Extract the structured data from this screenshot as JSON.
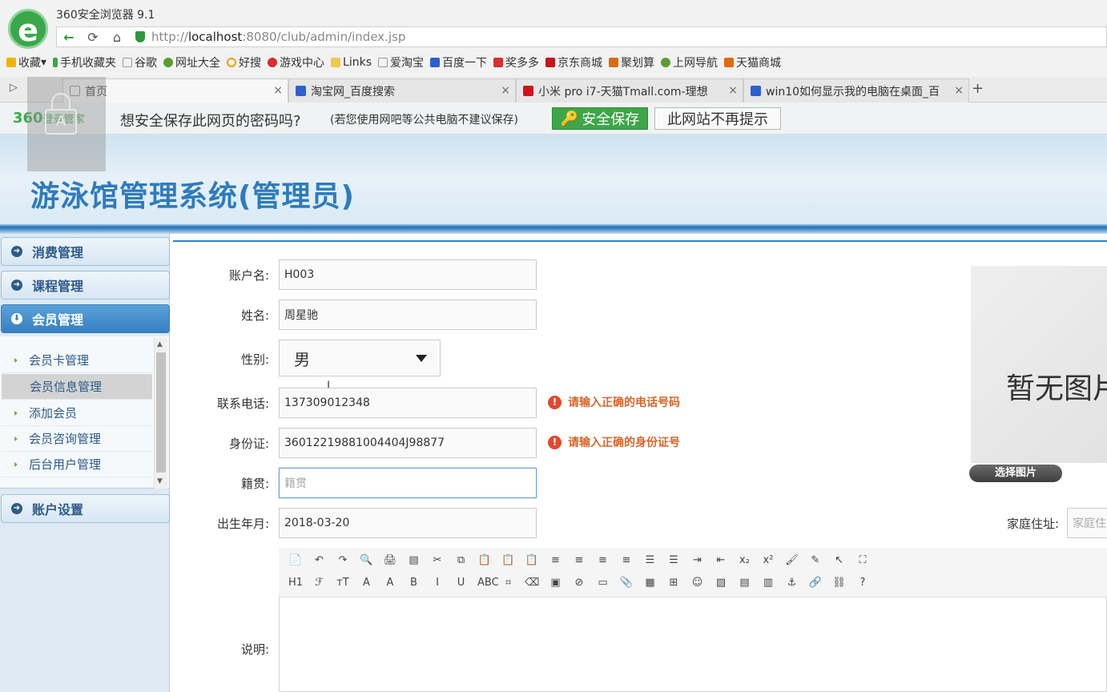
{
  "browser": {
    "title": "360安全浏览器 9.1",
    "url_prefix": "http://",
    "url_host": "localhost",
    "url_rest": ":8080/club/admin/index.jsp",
    "bookmarks": [
      "收藏",
      "手机收藏夹",
      "谷歌",
      "网址大全",
      "好搜",
      "游戏中心",
      "Links",
      "爱淘宝",
      "百度一下",
      "奖多多",
      "京东商城",
      "聚划算",
      "上网导航",
      "天猫商城"
    ],
    "tabs": [
      "首页",
      "淘宝网_百度搜索",
      "小米 pro i7-天猫Tmall.com-理想",
      "win10如何显示我的电脑在桌面_百"
    ],
    "new_tab": "+"
  },
  "password_bar": {
    "brand": "360",
    "brand_sub": "登录管家",
    "question": "想安全保存此网页的密码吗?",
    "note": "(若您使用网吧等公共电脑不建议保存)",
    "save_label": "安全保存",
    "never_label": "此网站不再提示"
  },
  "banner": {
    "title": "游泳馆管理系统(管理员)"
  },
  "sidebar": {
    "sections": [
      "消费管理",
      "课程管理",
      "会员管理",
      "账户设置"
    ],
    "items": [
      "会员卡管理",
      "会员信息管理",
      "添加会员",
      "会员咨询管理",
      "后台用户管理"
    ]
  },
  "form": {
    "account_label": "账户名:",
    "account_value": "H003",
    "name_label": "姓名:",
    "name_value": "周星驰",
    "gender_label": "性别:",
    "gender_value": "男",
    "phone_label": "联系电话:",
    "phone_value": "137309012348",
    "phone_error": "请输入正确的电话号码",
    "id_label": "身份证:",
    "id_value": "36012219881004404J98877",
    "id_error": "请输入正确的身份证号",
    "native_label": "籍贯:",
    "native_placeholder": "籍贯",
    "birth_label": "出生年月:",
    "birth_value": "2018-03-20",
    "address_label": "家庭住址:",
    "address_placeholder": "家庭住",
    "desc_label": "说明:",
    "photo_text": "暂无图片",
    "choose_photo": "选择图片"
  },
  "toolbar": {
    "row1": [
      "📄",
      "↶",
      "↷",
      "🔍",
      "🖨",
      "▤",
      "✂",
      "⧉",
      "📋",
      "📋",
      "📋",
      "≡",
      "≡",
      "≡",
      "≡",
      "☰",
      "☰",
      "⇥",
      "⇤",
      "x₂",
      "x²",
      "🖌",
      "✎",
      "↖",
      "⛶"
    ],
    "row2": [
      "H1",
      "ℱ",
      "тT",
      "A",
      "A",
      "B",
      "I",
      "U",
      "ABC",
      "⌗",
      "⌫",
      "▣",
      "⊘",
      "▭",
      "📎",
      "▦",
      "⊞",
      "☺",
      "▨",
      "▤",
      "▥",
      "⚓",
      "🔗",
      "⛓",
      "?"
    ]
  }
}
